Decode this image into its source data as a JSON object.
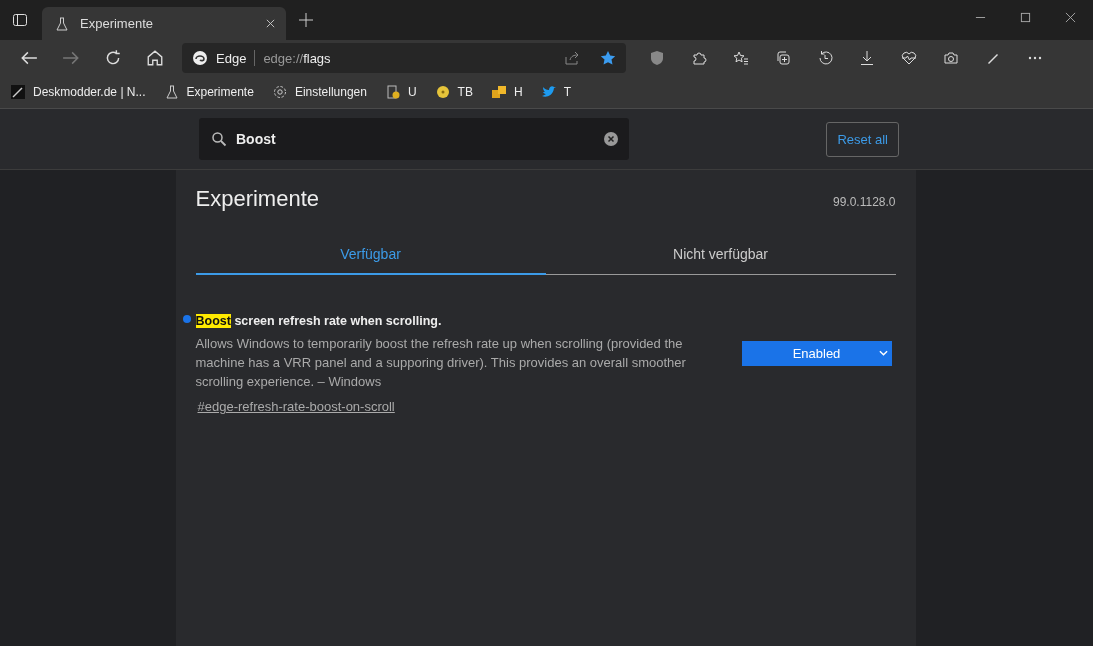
{
  "tab": {
    "title": "Experimente",
    "selected": true
  },
  "address": {
    "site": "Edge",
    "scheme": "edge://",
    "path": "flags"
  },
  "favorite": true,
  "bookmarks": [
    {
      "kind": "pen",
      "label": "Deskmodder.de | N..."
    },
    {
      "kind": "flask",
      "label": "Experimente"
    },
    {
      "kind": "gear",
      "label": "Einstellungen"
    },
    {
      "kind": "clipboard",
      "label": "U"
    },
    {
      "kind": "coin",
      "label": "TB"
    },
    {
      "kind": "squares",
      "label": "H"
    },
    {
      "kind": "bird",
      "label": "T"
    }
  ],
  "search": {
    "value": "Boost"
  },
  "reset_button": "Reset all",
  "page": {
    "title": "Experimente",
    "version": "99.0.1128.0"
  },
  "tabs": [
    {
      "label": "Verfügbar",
      "selected": true
    },
    {
      "label": "Nicht verfügbar",
      "selected": false
    }
  ],
  "flags": [
    {
      "modified": true,
      "match": "Boost",
      "title": " screen refresh rate when scrolling.",
      "description": "Allows Windows to temporarily boost the refresh rate up when scrolling (provided the machine has a VRR panel and a supporing driver). This provides an overall smoother scrolling experience. – Windows",
      "link": "#edge-refresh-rate-boost-on-scroll",
      "value": "Enabled"
    }
  ]
}
